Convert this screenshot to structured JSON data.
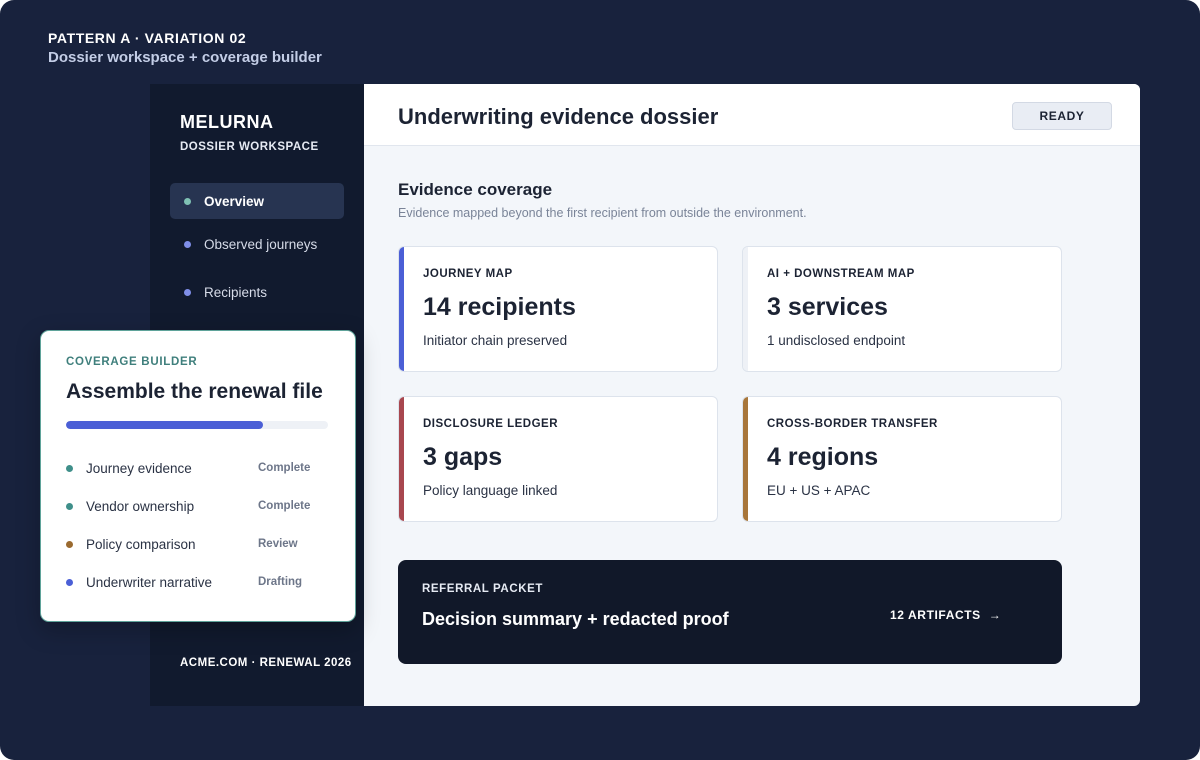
{
  "pattern": {
    "label": "PATTERN A · VARIATION 02",
    "subtitle": "Dossier workspace + coverage builder"
  },
  "sidebar": {
    "brand": "MELURNA",
    "brand_sub": "DOSSIER WORKSPACE",
    "items": [
      {
        "label": "Overview",
        "active": true,
        "dot_color": "#7fc1b4"
      },
      {
        "label": "Observed journeys",
        "active": false,
        "dot_color": "#7f8ee8"
      },
      {
        "label": "Recipients",
        "active": false,
        "dot_color": "#7f8ee8"
      }
    ],
    "footer": "ACME.COM · RENEWAL 2026"
  },
  "header": {
    "title": "Underwriting evidence dossier",
    "status_badge": "READY"
  },
  "coverage": {
    "title": "Evidence coverage",
    "subtitle": "Evidence mapped beyond the first recipient from outside the environment.",
    "cards": [
      {
        "label": "JOURNEY MAP",
        "value": "14 recipients",
        "note": "Initiator chain preserved",
        "accent": "#4b5fd6"
      },
      {
        "label": "AI + DOWNSTREAM MAP",
        "value": "3 services",
        "note": "1 undisclosed endpoint",
        "accent": "#eef1f6"
      },
      {
        "label": "DISCLOSURE LEDGER",
        "value": "3 gaps",
        "note": "Policy language linked",
        "accent": "#a8474f"
      },
      {
        "label": "CROSS-BORDER TRANSFER",
        "value": "4 regions",
        "note": "EU + US + APAC",
        "accent": "#a8763a"
      }
    ]
  },
  "referral": {
    "label": "REFERRAL PACKET",
    "title": "Decision summary + redacted proof",
    "link": "12 ARTIFACTS",
    "link_icon": "arrow-right-icon"
  },
  "builder": {
    "label": "COVERAGE BUILDER",
    "title": "Assemble the renewal file",
    "progress": 0.75,
    "progress_color": "#4b5fd6",
    "tasks": [
      {
        "name": "Journey evidence",
        "status": "Complete",
        "dot_color": "#3f8f8a"
      },
      {
        "name": "Vendor ownership",
        "status": "Complete",
        "dot_color": "#3f8f8a"
      },
      {
        "name": "Policy comparison",
        "status": "Review",
        "dot_color": "#9a6a2f"
      },
      {
        "name": "Underwriter narrative",
        "status": "Drafting",
        "dot_color": "#4b5fd6"
      }
    ]
  }
}
